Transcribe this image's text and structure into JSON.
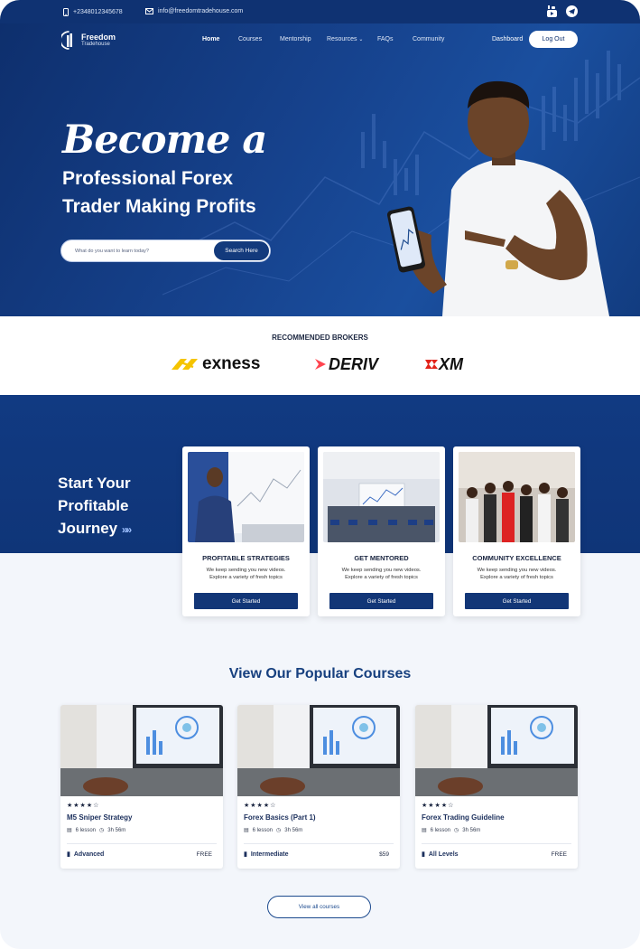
{
  "topbar": {
    "phone": "+2348012345678",
    "email": "info@freedomtradehouse.com",
    "icons": [
      "phone-icon",
      "mail-icon",
      "youtube-icon",
      "telegram-icon"
    ]
  },
  "logo": {
    "name": "Freedom",
    "sub": "Tradehouse"
  },
  "nav": {
    "items": [
      "Home",
      "Courses",
      "Mentorship",
      "Resources",
      "FAQs",
      "Community"
    ],
    "dashboard": "Dashboard",
    "logout": "Log Out"
  },
  "hero": {
    "script": "Become a",
    "line1": "Professional Forex",
    "line2": "Trader Making Profits",
    "search_placeholder": "What do you want to learn today?",
    "search_button": "Search Here"
  },
  "brokers": {
    "title": "RECOMMENDED BROKERS",
    "names": [
      "exness",
      "DERIV",
      "XM"
    ]
  },
  "journey": {
    "title_l1": "Start Your",
    "title_l2": "Profitable",
    "title_l3": "Journey",
    "cards": [
      {
        "title": "PROFITABLE STRATEGIES",
        "desc1": "We keep sending you new videos.",
        "desc2": "Explore a variety of fresh topics",
        "button": "Get Started"
      },
      {
        "title": "GET MENTORED",
        "desc1": "We keep sending you new videos.",
        "desc2": "Explore a variety of fresh topics",
        "button": "Get Started"
      },
      {
        "title": "COMMUNITY EXCELLENCE",
        "desc1": "We keep sending you new videos.",
        "desc2": "Explore a variety of fresh topics",
        "button": "Get Started"
      }
    ]
  },
  "popular": {
    "title": "View Our Popular Courses",
    "courses": [
      {
        "stars": "★★★★☆",
        "name": "M5 Sniper Strategy",
        "lessons": "6 lesson",
        "duration": "3h 56m",
        "level": "Advanced",
        "price": "FREE"
      },
      {
        "stars": "★★★★☆",
        "name": "Forex Basics (Part 1)",
        "lessons": "6 lesson",
        "duration": "3h 56m",
        "level": "Intermediate",
        "price": "$59"
      },
      {
        "stars": "★★★★☆",
        "name": "Forex Trading Guideline",
        "lessons": "6 lesson",
        "duration": "3h 56m",
        "level": "All Levels",
        "price": "FREE"
      }
    ],
    "view_all": "View all courses"
  },
  "colors": {
    "primary": "#0f3272",
    "accent": "#1c4a8e",
    "exness": "#f5c400",
    "deriv": "#ff444f",
    "xm": "#e2231a"
  }
}
